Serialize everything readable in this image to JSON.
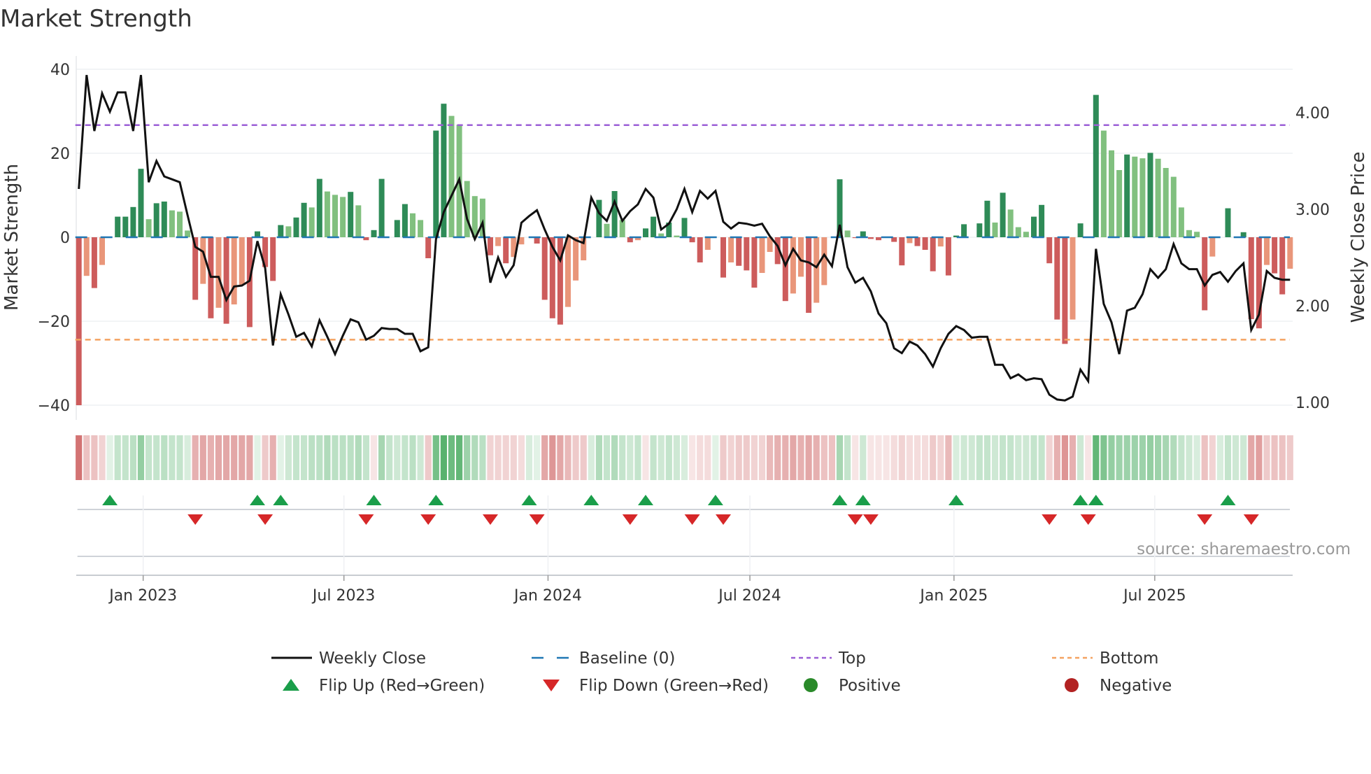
{
  "chart_data": {
    "type": "bar",
    "title": "Market Strength",
    "ylabel": "Market Strength",
    "y2label": "Weekly Close Price",
    "ylim": [
      -40,
      40
    ],
    "y2lim": [
      1.0,
      4.0
    ],
    "yticks": [
      40,
      20,
      0,
      -20,
      -40
    ],
    "yticklabels": [
      "40",
      "20",
      "0",
      "−20",
      "−40"
    ],
    "y2ticks": [
      4.0,
      3.0,
      2.0,
      1.0
    ],
    "y2ticklabels": [
      "4.00",
      "3.00",
      "2.00",
      "1.00"
    ],
    "x_start": "2022-11-04",
    "x_interval": "weekly",
    "xticks": [
      {
        "date": "2023-01-01",
        "label": "Jan 2023"
      },
      {
        "date": "2023-07-01",
        "label": "Jul 2023"
      },
      {
        "date": "2024-01-01",
        "label": "Jan 2024"
      },
      {
        "date": "2024-07-01",
        "label": "Jul 2024"
      },
      {
        "date": "2025-01-01",
        "label": "Jan 2025"
      },
      {
        "date": "2025-07-01",
        "label": "Jul 2025"
      }
    ],
    "top_level": 26.7,
    "bottom_level": -24.4,
    "baseline": 0,
    "grid": true,
    "legend_position": "bottom",
    "series": [
      {
        "name": "Market Strength",
        "type": "bar",
        "values": [
          -40,
          -9.2,
          -12.1,
          -6.6,
          0,
          4.9,
          4.9,
          7.2,
          16.3,
          4.3,
          8.1,
          8.5,
          6.4,
          6.1,
          1.6,
          -14.9,
          -11.1,
          -19.3,
          -16.8,
          -20.6,
          -16,
          -11.3,
          -21.4,
          1.4,
          -7.1,
          -10.4,
          2.9,
          2.6,
          4.7,
          8.2,
          7.1,
          13.9,
          10.9,
          10.1,
          9.6,
          10.8,
          7.6,
          -0.7,
          1.7,
          13.9,
          0,
          4.1,
          7.9,
          5.7,
          4.1,
          -5,
          25.4,
          31.8,
          28.9,
          26.8,
          13.4,
          9.8,
          9.2,
          -4.3,
          -2.1,
          -6.2,
          -4.7,
          -1.7,
          0,
          -1.5,
          -14.9,
          -19.3,
          -20.8,
          -16.6,
          -10.3,
          -5.5,
          0,
          8.9,
          3.2,
          11,
          4.1,
          -1.2,
          -0.7,
          2.1,
          4.9,
          0.9,
          3.5,
          0.4,
          4.6,
          -1.2,
          -6,
          -3,
          0,
          -9.6,
          -6,
          -6.8,
          -7.9,
          -12,
          -8.5,
          -3.5,
          -6.4,
          -15.2,
          -13.4,
          -9.4,
          -18,
          -15.6,
          -11.4,
          0,
          13.8,
          1.6,
          -0.2,
          1.4,
          -0.4,
          -0.7,
          0,
          -1.1,
          -6.7,
          -1.4,
          -2.1,
          -3,
          -8.1,
          -2.2,
          -9.1,
          0.4,
          3.1,
          0,
          3.3,
          8.7,
          3.5,
          10.6,
          6.6,
          2.4,
          1.3,
          4.9,
          7.7,
          -6.2,
          -19.6,
          -25.4,
          -19.6,
          3.3,
          0,
          33.9,
          25.4,
          20.7,
          16,
          19.7,
          19.2,
          18.8,
          20.1,
          18.7,
          16.5,
          14.4,
          7.1,
          1.7,
          1.3,
          -17.4,
          -4.6,
          0,
          6.9,
          0,
          1.2,
          -19.5,
          -21.7,
          -6.6,
          -8.6,
          -13.6,
          -7.5
        ]
      },
      {
        "name": "Weekly Close",
        "type": "line",
        "axis": "right",
        "values": [
          3.21,
          4.39,
          3.81,
          4.2,
          4.01,
          4.21,
          4.21,
          3.81,
          4.39,
          3.28,
          3.5,
          3.34,
          3.31,
          3.28,
          2.94,
          2.61,
          2.56,
          2.3,
          2.3,
          2.06,
          2.2,
          2.21,
          2.26,
          2.67,
          2.39,
          1.59,
          2.12,
          1.91,
          1.68,
          1.72,
          1.58,
          1.85,
          1.68,
          1.5,
          1.69,
          1.86,
          1.83,
          1.65,
          1.69,
          1.77,
          1.76,
          1.76,
          1.71,
          1.71,
          1.53,
          1.57,
          2.69,
          2.97,
          3.14,
          3.31,
          2.9,
          2.69,
          2.86,
          2.24,
          2.5,
          2.3,
          2.42,
          2.86,
          2.93,
          2.99,
          2.79,
          2.61,
          2.47,
          2.73,
          2.68,
          2.65,
          3.12,
          2.96,
          2.88,
          3.08,
          2.88,
          2.98,
          3.05,
          3.21,
          3.12,
          2.79,
          2.85,
          3.0,
          3.21,
          2.97,
          3.19,
          3.11,
          3.19,
          2.87,
          2.8,
          2.86,
          2.85,
          2.83,
          2.85,
          2.72,
          2.62,
          2.42,
          2.59,
          2.47,
          2.45,
          2.4,
          2.53,
          2.41,
          2.84,
          2.4,
          2.24,
          2.29,
          2.15,
          1.92,
          1.82,
          1.56,
          1.51,
          1.63,
          1.59,
          1.5,
          1.37,
          1.56,
          1.71,
          1.79,
          1.75,
          1.67,
          1.68,
          1.68,
          1.39,
          1.39,
          1.25,
          1.29,
          1.23,
          1.25,
          1.24,
          1.08,
          1.03,
          1.02,
          1.06,
          1.34,
          1.22,
          2.59,
          2.02,
          1.83,
          1.5,
          1.95,
          1.98,
          2.12,
          2.38,
          2.29,
          2.38,
          2.64,
          2.44,
          2.38,
          2.38,
          2.21,
          2.32,
          2.35,
          2.25,
          2.36,
          2.44,
          1.75,
          1.91,
          2.36,
          2.29,
          2.27,
          2.27
        ]
      },
      {
        "name": "Regime Strip",
        "type": "heatmap",
        "values": [
          -0.8,
          -0.35,
          -0.35,
          -0.25,
          0.15,
          0.3,
          0.3,
          0.35,
          0.55,
          0.3,
          0.3,
          0.35,
          0.3,
          0.3,
          0.2,
          -0.45,
          -0.5,
          -0.45,
          -0.5,
          -0.5,
          -0.5,
          -0.5,
          -0.5,
          0.15,
          -0.3,
          -0.45,
          0.15,
          0.25,
          0.3,
          0.3,
          0.35,
          0.35,
          0.4,
          0.35,
          0.35,
          0.35,
          0.4,
          0.3,
          -0.15,
          0.45,
          0.3,
          0.25,
          0.3,
          0.35,
          0.25,
          -0.3,
          0.7,
          0.85,
          0.75,
          0.8,
          0.5,
          0.4,
          0.35,
          -0.25,
          -0.25,
          -0.25,
          -0.25,
          -0.2,
          0.2,
          0.15,
          -0.5,
          -0.6,
          -0.5,
          -0.4,
          -0.3,
          -0.3,
          0.2,
          0.4,
          0.3,
          0.4,
          0.3,
          0.25,
          0.3,
          -0.15,
          0.3,
          0.25,
          0.3,
          0.25,
          0.2,
          -0.15,
          -0.2,
          -0.2,
          0.15,
          -0.3,
          -0.25,
          -0.3,
          -0.3,
          -0.25,
          -0.25,
          -0.4,
          -0.45,
          -0.45,
          -0.5,
          -0.45,
          -0.5,
          -0.45,
          -0.35,
          -0.35,
          0.45,
          0.3,
          -0.15,
          0.25,
          -0.15,
          -0.15,
          -0.15,
          -0.2,
          -0.25,
          -0.2,
          -0.2,
          -0.2,
          -0.3,
          -0.25,
          -0.4,
          0.2,
          0.25,
          0.25,
          0.3,
          0.3,
          0.25,
          0.3,
          0.3,
          0.25,
          0.25,
          0.3,
          0.3,
          -0.25,
          -0.45,
          -0.6,
          -0.45,
          0.25,
          -0.15,
          0.8,
          0.65,
          0.55,
          0.5,
          0.5,
          0.5,
          0.5,
          0.55,
          0.5,
          0.45,
          0.4,
          0.3,
          0.25,
          0.2,
          -0.35,
          -0.25,
          0.2,
          0.3,
          0.25,
          0.25,
          -0.5,
          -0.55,
          -0.3,
          -0.35,
          -0.35,
          -0.3
        ]
      }
    ],
    "flip_up_weeks": [
      4,
      23,
      26,
      38,
      46,
      58,
      66,
      73,
      82,
      98,
      101,
      113,
      129,
      131,
      148
    ],
    "flip_down_weeks": [
      15,
      24,
      37,
      45,
      53,
      59,
      71,
      79,
      83,
      100,
      102,
      125,
      130,
      145,
      151
    ],
    "annotation": "source: sharemaestro.com",
    "legend": [
      {
        "label": "Weekly Close",
        "symbol": "line"
      },
      {
        "label": "Baseline (0)",
        "symbol": "dash"
      },
      {
        "label": "Top",
        "symbol": "dot-top"
      },
      {
        "label": "Bottom",
        "symbol": "dot-bottom"
      },
      {
        "label": "Flip Up (Red→Green)",
        "symbol": "tri-up"
      },
      {
        "label": "Flip Down (Green→Red)",
        "symbol": "tri-down"
      },
      {
        "label": "Positive",
        "symbol": "circle-pos"
      },
      {
        "label": "Negative",
        "symbol": "circle-neg"
      }
    ],
    "colors": {
      "pos_rising": "#2e8b57",
      "pos_falling": "#81c07f",
      "neg_falling": "#cd5c5c",
      "neg_rising": "#e9967a",
      "close": "#111111",
      "baseline": "#1f77b4",
      "top": "#9b5fd6",
      "bottom": "#f4a261",
      "flip_up": "#1a9e4a",
      "flip_down": "#d62728",
      "positive": "#2a8a2a",
      "negative": "#b22222"
    }
  }
}
